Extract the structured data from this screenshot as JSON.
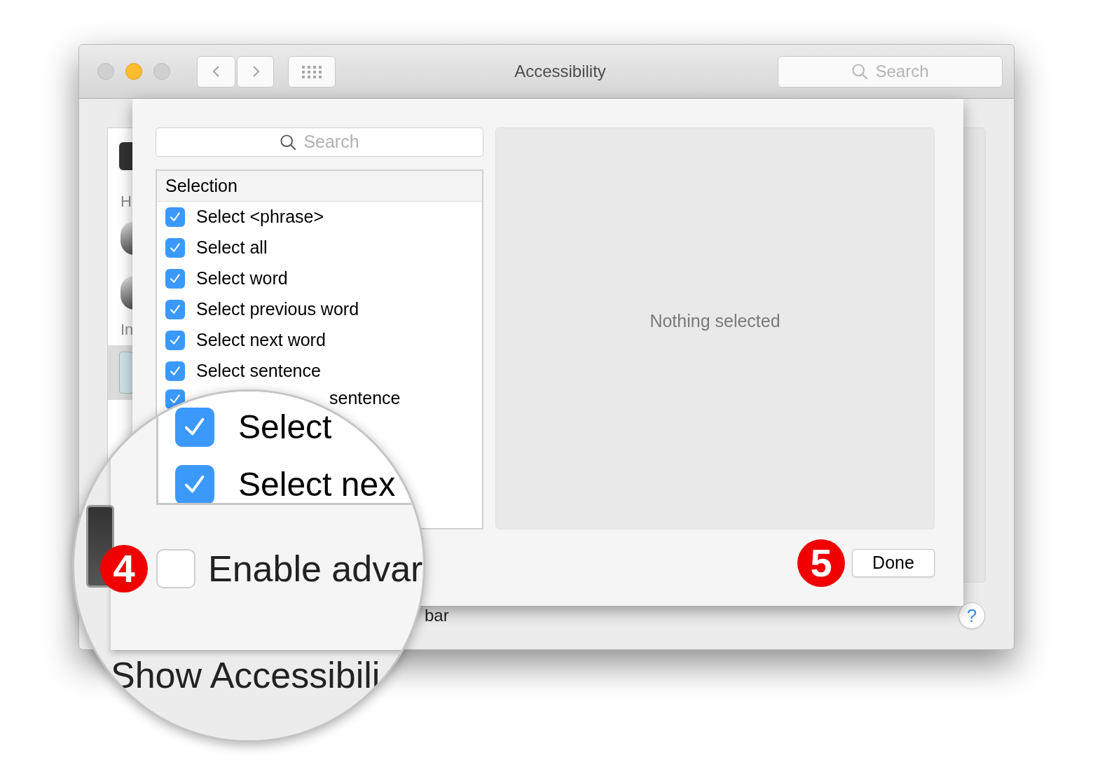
{
  "window": {
    "title": "Accessibility",
    "search": {
      "placeholder": "Search"
    }
  },
  "background": {
    "sidebar_labels": [
      "H",
      "In"
    ],
    "caption_tail": "bar",
    "help": "?"
  },
  "sheet": {
    "search": {
      "placeholder": "Search"
    },
    "list": {
      "header": "Selection",
      "items": [
        {
          "label": "Select <phrase>",
          "checked": true,
          "kind": "full"
        },
        {
          "label": "Select all",
          "checked": true,
          "kind": "full"
        },
        {
          "label": "Select word",
          "checked": true,
          "kind": "full"
        },
        {
          "label": "Select previous word",
          "checked": true,
          "kind": "full"
        },
        {
          "label": "Select next word",
          "checked": true,
          "kind": "full"
        },
        {
          "label": "Select sentence",
          "checked": true,
          "kind": "full"
        },
        {
          "label": "sentence",
          "checked": true,
          "kind": "covered"
        }
      ]
    },
    "detail": "Nothing selected",
    "done": "Done",
    "callout": "5"
  },
  "magnifier": {
    "items": [
      {
        "label": "Select",
        "checked": true
      },
      {
        "label": "Select nex",
        "checked": true
      }
    ],
    "option": {
      "label": "Enable advar",
      "checked": false
    },
    "callout": "4",
    "caption": "Show Accessibili"
  }
}
